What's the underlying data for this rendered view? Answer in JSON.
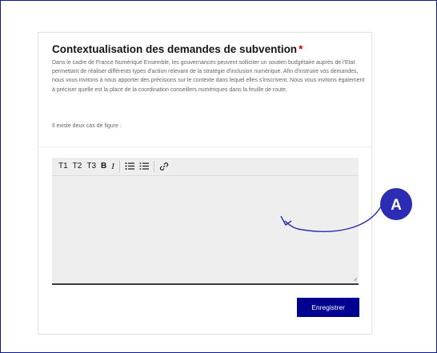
{
  "section": {
    "title": "Contextualisation des demandes de subvention",
    "required_mark": "*",
    "description": "Dans le cadre de France Numérique Ensemble, les gouvernances peuvent solliciter un soutien budgétaire auprès de l'Etat permettant de réaliser différents types d'action relevant de la stratégie d'inclusion numérique. Afin d'instruire vos demandes, nous vous invitons à nous apporter des précisions sur le contexte dans lequel elles s'inscrivent. Nous vous invitons également à préciser quelle est la place de la coordination conseillers numériques dans la feuille de route.",
    "intro": "Il existe deux cas de figure :"
  },
  "toolbar": {
    "h1": "T1",
    "h2": "T2",
    "h3": "T3",
    "bold": "B",
    "italic": "I",
    "bullet_icon": "bullet-list-icon",
    "ordered_icon": "ordered-list-icon",
    "link_icon": "link-icon"
  },
  "editor": {
    "value": ""
  },
  "actions": {
    "save_label": "Enregistrer"
  },
  "annotation": {
    "label": "A"
  },
  "colors": {
    "primary": "#000091",
    "required": "#ce0500",
    "frame": "#0c1a8f",
    "editor_bg": "#eeeeee",
    "annotation": "#2b2bb3"
  }
}
